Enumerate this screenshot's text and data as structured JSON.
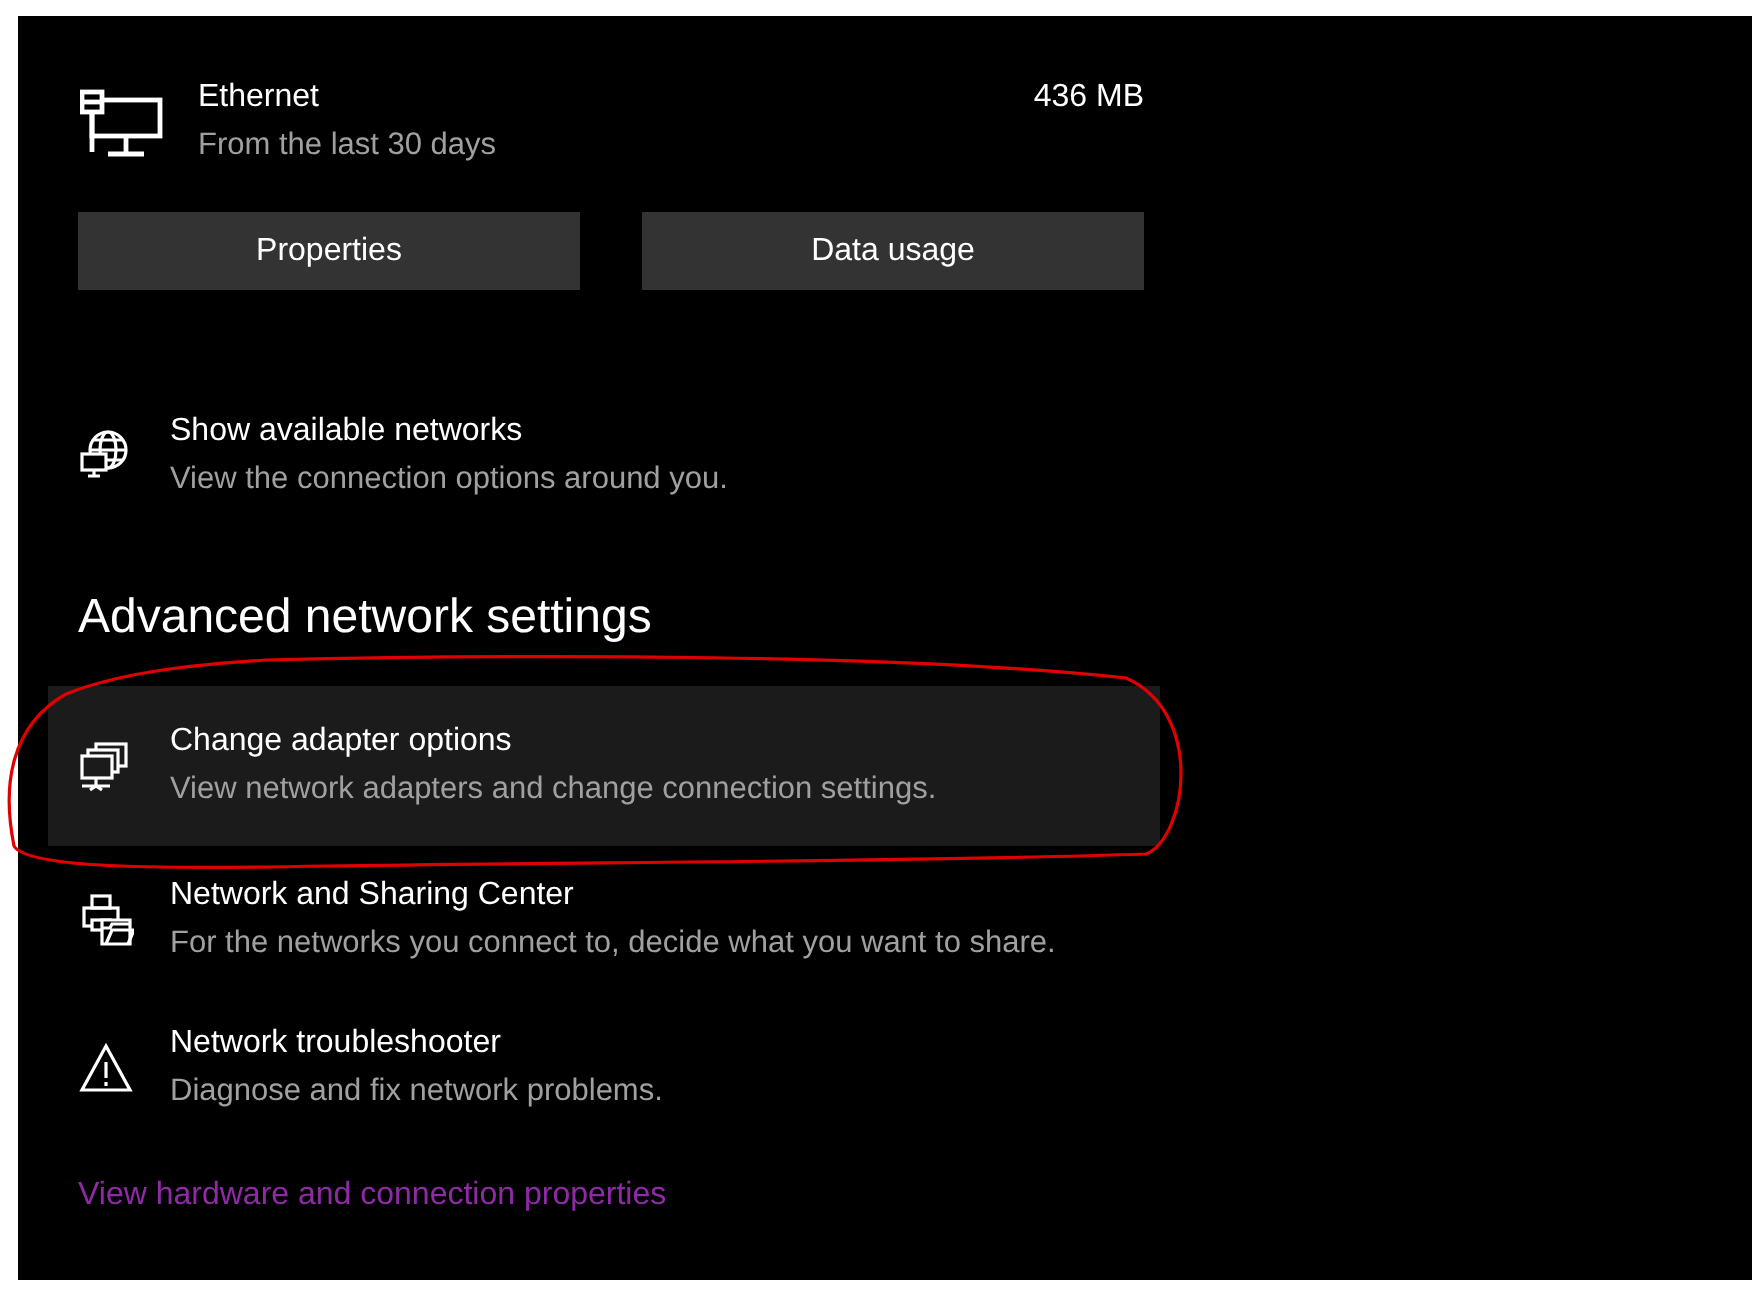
{
  "connection": {
    "name": "Ethernet",
    "period": "From the last 30 days",
    "usage": "436 MB"
  },
  "buttons": [
    "Properties",
    "Data usage"
  ],
  "top_items": [
    {
      "kind": "globe",
      "title": "Show available networks",
      "description": "View the connection options around you.",
      "highlighted": false
    }
  ],
  "advanced": {
    "heading": "Advanced network settings",
    "items": [
      {
        "kind": "adapters",
        "title": "Change adapter options",
        "description": "View network adapters and change connection settings.",
        "highlighted": true
      },
      {
        "kind": "sharing",
        "title": "Network and Sharing Center",
        "description": "For the networks you connect to, decide what you want to share.",
        "highlighted": false
      },
      {
        "kind": "warning",
        "title": "Network troubleshooter",
        "description": "Diagnose and fix network problems.",
        "highlighted": false
      }
    ]
  },
  "link": "View hardware and connection properties"
}
